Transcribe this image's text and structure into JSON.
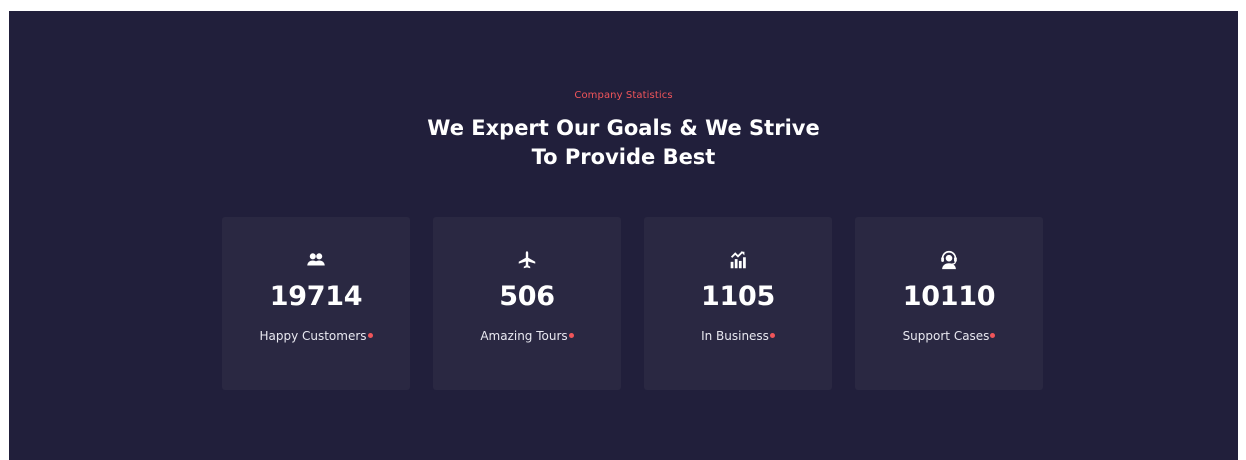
{
  "section": {
    "eyebrow": "Company Statistics",
    "headline_line1": "We Expert Our Goals & We Strive",
    "headline_line2": "To Provide Best"
  },
  "stats": [
    {
      "icon": "users-icon",
      "value": "19714",
      "label": "Happy Customers"
    },
    {
      "icon": "airplane-icon",
      "value": "506",
      "label": "Amazing Tours"
    },
    {
      "icon": "chart-growth-icon",
      "value": "1105",
      "label": "In Business"
    },
    {
      "icon": "support-agent-icon",
      "value": "10110",
      "label": "Support Cases"
    }
  ],
  "colors": {
    "background": "#211f3b",
    "card": "#2a2842",
    "accent": "#f0555a",
    "text": "#ffffff"
  }
}
